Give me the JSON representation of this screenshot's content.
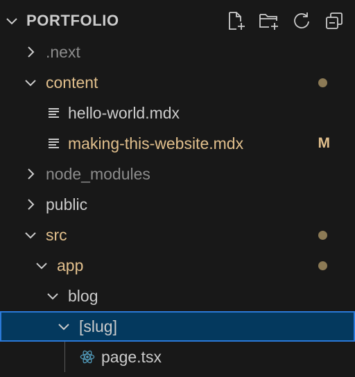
{
  "colors": {
    "default_text": "#cccccc",
    "modified_text": "#e2c08d",
    "ignored_text": "#8c8c8c",
    "modified_dot": "#8c7a55",
    "selection_bg": "#04395e",
    "selection_border": "#2b79d8",
    "react_icon": "#519aba"
  },
  "header": {
    "title": "PORTFOLIO",
    "actions": [
      {
        "name": "new-file-icon"
      },
      {
        "name": "new-folder-icon"
      },
      {
        "name": "refresh-icon"
      },
      {
        "name": "collapse-all-icon"
      }
    ]
  },
  "tree": [
    {
      "label": ".next",
      "type": "folder",
      "expanded": false,
      "status": "ignored",
      "decoration": ""
    },
    {
      "label": "content",
      "type": "folder",
      "expanded": true,
      "status": "modified",
      "decoration": "dot"
    },
    {
      "label": "hello-world.mdx",
      "type": "file",
      "icon": "file-lines-icon",
      "status": "default",
      "decoration": ""
    },
    {
      "label": "making-this-website.mdx",
      "type": "file",
      "icon": "file-lines-icon",
      "status": "modified",
      "decoration": "M"
    },
    {
      "label": "node_modules",
      "type": "folder",
      "expanded": false,
      "status": "ignored",
      "decoration": ""
    },
    {
      "label": "public",
      "type": "folder",
      "expanded": false,
      "status": "default",
      "decoration": ""
    },
    {
      "label": "src",
      "type": "folder",
      "expanded": true,
      "status": "modified",
      "decoration": "dot"
    },
    {
      "label": "app",
      "type": "folder",
      "expanded": true,
      "status": "modified",
      "decoration": "dot"
    },
    {
      "label": "blog",
      "type": "folder",
      "expanded": true,
      "status": "default",
      "decoration": ""
    },
    {
      "label": "[slug]",
      "type": "folder",
      "expanded": true,
      "status": "default",
      "decoration": "",
      "selected": true
    },
    {
      "label": "page.tsx",
      "type": "file",
      "icon": "react-icon",
      "status": "default",
      "decoration": ""
    }
  ]
}
